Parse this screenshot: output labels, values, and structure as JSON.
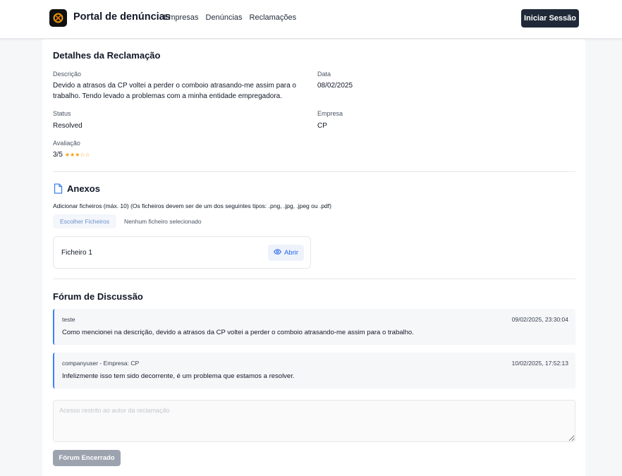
{
  "header": {
    "brand": "Portal de denúncias",
    "nav": [
      "Empresas",
      "Denúncias",
      "Reclamações"
    ],
    "login_label": "Iniciar Sessão"
  },
  "details": {
    "title": "Detalhes da Reclamação",
    "description_label": "Descrição",
    "description_line1": "Devido a atrasos da CP voltei a perder o comboio atrasando-me assim para o",
    "description_line2": "trabalho. Tendo levado a problemas com a minha entidade empregadora.",
    "date_label": "Data",
    "date_value": "08/02/2025",
    "status_label": "Status",
    "status_value": "Resolved",
    "company_label": "Empresa",
    "company_value": "CP",
    "rating_label": "Avaliação",
    "rating_value": "3/5",
    "rating_stars": "★★★☆☆",
    "rating_score": 3,
    "rating_max": 5
  },
  "attachments": {
    "title": "Anexos",
    "hint": "Adicionar ficheiros (máx. 10) (Os ficheiros devem ser de um dos seguintes tipos: .png, .jpg, .jpeg ou .pdf)",
    "choose_label": "Escolher Ficheiros",
    "no_file_label": "Nenhum ficheiro selecionado",
    "files": [
      {
        "name": "Ficheiro 1",
        "open_label": "Abrir"
      }
    ]
  },
  "forum": {
    "title": "Fórum de Discussão",
    "messages": [
      {
        "author": "teste",
        "date": "09/02/2025, 23:30:04",
        "text": "Como mencionei na descrição, devido a atrasos da CP voltei a perder o comboio atrasando-me assim para o trabalho."
      },
      {
        "author": "companyuser - Empresa: CP",
        "date": "10/02/2025, 17:52:13",
        "text": "Infelizmente isso tem sido decorrente, é um problema que estamos a resolver."
      }
    ],
    "input_placeholder": "Acesso restrito ao autor da reclamação",
    "closed_label": "Fórum Encerrado"
  },
  "colors": {
    "accent": "#3b82f6",
    "dark_button": "#1f2937",
    "star": "#f59e0b",
    "disabled": "#9ca3af"
  },
  "icons": {
    "logo": "brand-logo-icon",
    "document": "document-icon",
    "eye": "eye-icon"
  }
}
